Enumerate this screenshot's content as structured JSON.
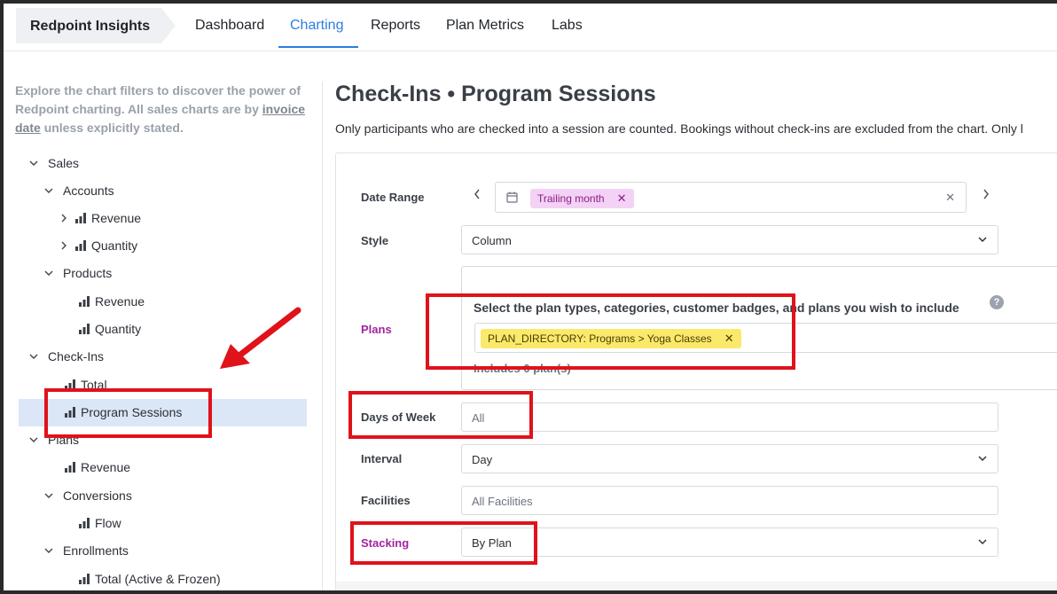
{
  "brand": "Redpoint Insights",
  "nav": [
    {
      "label": "Dashboard",
      "active": false
    },
    {
      "label": "Charting",
      "active": true
    },
    {
      "label": "Reports",
      "active": false
    },
    {
      "label": "Plan Metrics",
      "active": false
    },
    {
      "label": "Labs",
      "active": false
    }
  ],
  "intro": {
    "line1": "Explore the chart filters to discover the power of Redpoint charting. All sales charts are by",
    "link": "invoice date",
    "line2": "unless explicitly stated."
  },
  "tree": [
    {
      "label": "Sales",
      "icon": "chevron-down-icon",
      "level": 0
    },
    {
      "label": "Accounts",
      "icon": "chevron-down-icon",
      "level": 1
    },
    {
      "label": "Revenue",
      "icon": "chevron-right-icon",
      "bars": true,
      "level": 2
    },
    {
      "label": "Quantity",
      "icon": "chevron-right-icon",
      "bars": true,
      "level": 2
    },
    {
      "label": "Products",
      "icon": "chevron-down-icon",
      "level": 1
    },
    {
      "label": "Revenue",
      "bars": true,
      "level": 3
    },
    {
      "label": "Quantity",
      "bars": true,
      "level": 3
    },
    {
      "label": "Check-Ins",
      "icon": "chevron-down-icon",
      "level": 0
    },
    {
      "label": "Total",
      "bars": true,
      "level": 2
    },
    {
      "label": "Program Sessions",
      "bars": true,
      "level": 2,
      "selected": true
    },
    {
      "label": "Plans",
      "icon": "chevron-down-icon",
      "level": 0
    },
    {
      "label": "Revenue",
      "bars": true,
      "level": 2
    },
    {
      "label": "Conversions",
      "icon": "chevron-down-icon",
      "level": 1
    },
    {
      "label": "Flow",
      "bars": true,
      "level": 3
    },
    {
      "label": "Enrollments",
      "icon": "chevron-down-icon",
      "level": 1
    },
    {
      "label": "Total (Active & Frozen)",
      "bars": true,
      "level": 3
    }
  ],
  "page": {
    "title": "Check-Ins • Program Sessions",
    "subtitle": "Only participants who are checked into a session are counted. Bookings without check-ins are excluded from the chart. Only l"
  },
  "filters": {
    "date_range": {
      "label": "Date Range",
      "tag": "Trailing month"
    },
    "style": {
      "label": "Style",
      "value": "Column"
    },
    "plans": {
      "label": "Plans",
      "prompt": "Select the plan types, categories, customer badges, and plans you wish to include",
      "tag": "PLAN_DIRECTORY: Programs > Yoga Classes",
      "includes": "Includes 0 plan(s)"
    },
    "days_of_week": {
      "label": "Days of Week",
      "placeholder": "All"
    },
    "interval": {
      "label": "Interval",
      "value": "Day"
    },
    "facilities": {
      "label": "Facilities",
      "placeholder": "All Facilities"
    },
    "stacking": {
      "label": "Stacking",
      "value": "By Plan"
    }
  },
  "colors": {
    "accent": "#2b7de0",
    "purple_label": "#a3239e",
    "tag_purple": "#f3d2f5",
    "tag_yellow": "#fbe96b",
    "highlight": "#e0121a",
    "selected_row": "#dbe6f7"
  }
}
